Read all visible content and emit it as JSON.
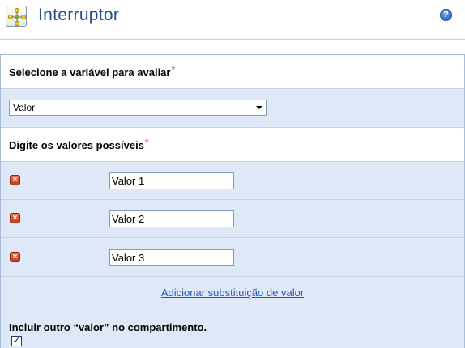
{
  "header": {
    "title": "Interruptor",
    "app_icon": "flowchart-icon",
    "help_icon": "help-icon",
    "help_glyph": "?"
  },
  "variable_section": {
    "label": "Selecione a variável para avaliar",
    "required_marker": "*",
    "select_value": "Valor"
  },
  "values_section": {
    "label": "Digite os valores possíveis",
    "required_marker": "*",
    "items": [
      {
        "value": "Valor 1"
      },
      {
        "value": "Valor 2"
      },
      {
        "value": "Valor 3"
      }
    ],
    "delete_glyph": "×",
    "add_link": "Adicionar substituição de valor"
  },
  "include_other": {
    "label": "Incluir outro “valor” no compartimento.",
    "checked": true,
    "check_glyph": "✓"
  },
  "colors": {
    "title": "#1f4e8a",
    "panel_band": "#dfe8f6",
    "link": "#1f59b7",
    "required": "#d03b1f",
    "delete_icon": "#c53b19"
  }
}
